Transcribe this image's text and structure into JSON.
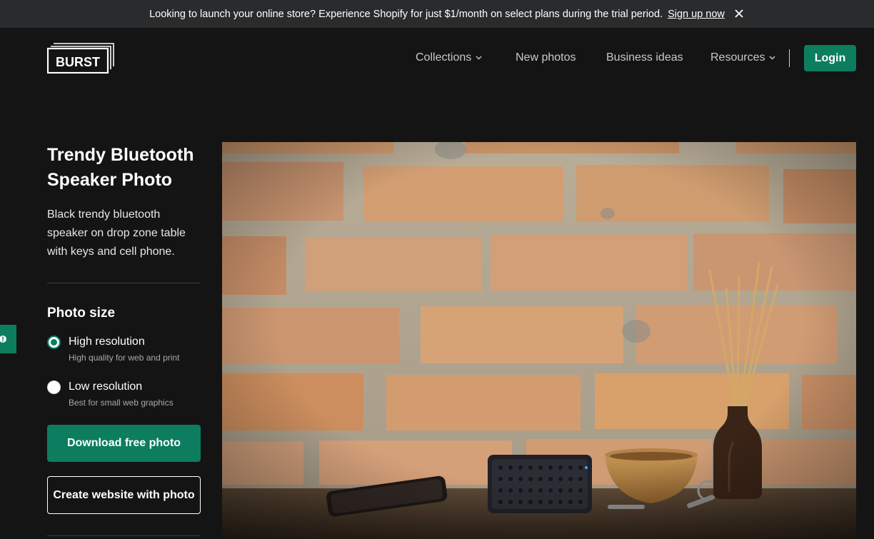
{
  "announcement": {
    "message": "Looking to launch your online store? Experience Shopify for just $1/month on select plans during the trial period.",
    "link": "Sign up now",
    "close_icon": "close-icon"
  },
  "header": {
    "logo_text": "BURST",
    "nav": [
      {
        "label": "Collections",
        "has_dropdown": true
      },
      {
        "label": "New photos",
        "has_dropdown": false
      },
      {
        "label": "Business ideas",
        "has_dropdown": false
      },
      {
        "label": "Resources",
        "has_dropdown": true
      }
    ],
    "login_label": "Login"
  },
  "photo_info": {
    "title": "Trendy Bluetooth Speaker Photo",
    "description": "Black trendy bluetooth speaker on drop zone table with keys and cell phone.",
    "size_heading": "Photo size",
    "options": [
      {
        "label": "High resolution",
        "sub": "High quality for web and print",
        "selected": true
      },
      {
        "label": "Low resolution",
        "sub": "Best for small web graphics",
        "selected": false
      }
    ],
    "download_label": "Download free photo",
    "create_label": "Create website with photo"
  },
  "colors": {
    "background": "#141414",
    "announcement_bg": "#2a2b2d",
    "accent_green": "#0d7d5f"
  }
}
